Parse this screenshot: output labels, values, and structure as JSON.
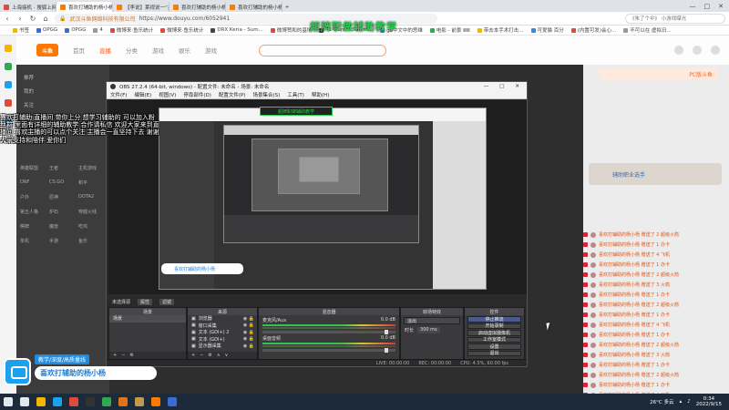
{
  "browser": {
    "tabs": [
      {
        "label": "上海接机 · 搜狐上网 从这里开始",
        "color": "#e04a3a",
        "active": false
      },
      {
        "label": "喜欢打辅助的杨小杨 个人空间_斗鱼",
        "color": "#ff7a00",
        "active": true
      },
      {
        "label": "【李说】莱视说一“共同”——路线教学",
        "color": "#ff7a00",
        "active": false
      },
      {
        "label": "喜欢打辅助的杨小杨的直播间",
        "color": "#ff7a00",
        "active": false
      },
      {
        "label": "喜欢打辅助的杨小杨 直播间直播_斗鱼",
        "color": "#ff7a00",
        "active": false
      }
    ],
    "window_controls": [
      "—",
      "□",
      "✕"
    ],
    "address": {
      "site_name": "武汉斗鱼网络科技有限公司",
      "url": "https://www.douyu.com/6052941",
      "search_text": "《朱了个伞》 小游戏曝光"
    },
    "bookmarks": [
      {
        "label": "书签",
        "color": "#f5b400"
      },
      {
        "label": "OPGG",
        "color": "#3b6bd6"
      },
      {
        "label": "OPGG",
        "color": "#3b6bd6"
      },
      {
        "label": "4",
        "color": "#999999"
      },
      {
        "label": "微博来·鱼乐统计",
        "color": "#e04a3a"
      },
      {
        "label": "微博来·鱼乐统计",
        "color": "#e04a3a"
      },
      {
        "label": "DRX Keria - Sum...",
        "color": "#444444"
      },
      {
        "label": "微博赞和的基情",
        "color": "#e04a3a"
      },
      {
        "label": "T1 Gumi - Summ...",
        "color": "#444444"
      },
      {
        "label": "go中文中的思维",
        "color": "#2a8af6"
      },
      {
        "label": "电影 - 前景 ⅢⅢ",
        "color": "#33a852"
      },
      {
        "label": "带去本手术打击...",
        "color": "#f5b400"
      },
      {
        "label": "可爱猫 百分",
        "color": "#2a8af6"
      },
      {
        "label": "(内置可发)会心...",
        "color": "#e04a3a"
      },
      {
        "label": "不可以在 虚拟日...",
        "color": "#999999"
      }
    ]
  },
  "douyu": {
    "logo": "斗鱼",
    "nav": [
      {
        "label": "首页",
        "hot": false
      },
      {
        "label": "直播",
        "hot": true
      },
      {
        "label": "分类",
        "hot": false
      },
      {
        "label": "游戏",
        "hot": false
      },
      {
        "label": "娱乐",
        "hot": false
      },
      {
        "label": "游戏",
        "hot": false
      }
    ],
    "banner": "超牌职做辅助教学",
    "sidebar": {
      "items": [
        "推荐",
        "我的",
        "关注",
        "专题",
        "推荐",
        "综合直播",
        "王者荣耀",
        "球球大作战",
        "和平精英",
        "英雄联盟",
        "CS:GO",
        "原神",
        "LOL",
        "DNF",
        "LOL"
      ],
      "grid": [
        "英雄联盟",
        "王者",
        "主机游戏",
        "DNF",
        "CS:GO",
        "和平",
        "户外",
        "原神",
        "DOTA2",
        "第五人格",
        "炉石",
        "穿越火线",
        "棋牌",
        "魔兽",
        "吃鸡",
        "单机",
        "手游",
        "鱼乐"
      ]
    },
    "right_header": "PC版斗鱼",
    "right_title": "辅助职业选手",
    "rank_list": [
      "喜欢打辅助的杨小杨 赠送了 2 超级火箭",
      "喜欢打辅助的杨小杨 赠送了 1 办卡",
      "喜欢打辅助的杨小杨 赠送了 4 飞机",
      "喜欢打辅助的杨小杨 赠送了 1 办卡",
      "喜欢打辅助的杨小杨 赠送了 2 超级火箭",
      "喜欢打辅助的杨小杨 赠送了 3 火箭",
      "喜欢打辅助的杨小杨 赠送了 1 办卡",
      "喜欢打辅助的杨小杨 赠送了 2 超级火箭",
      "喜欢打辅助的杨小杨 赠送了 1 办卡",
      "喜欢打辅助的杨小杨 赠送了 4 飞机",
      "喜欢打辅助的杨小杨 赠送了 1 办卡",
      "喜欢打辅助的杨小杨 赠送了 2 超级火箭",
      "喜欢打辅助的杨小杨 赠送了 3 火箭",
      "喜欢打辅助的杨小杨 赠送了 1 办卡",
      "喜欢打辅助的杨小杨 赠送了 2 超级火箭",
      "喜欢打辅助的杨小杨 赠送了 1 办卡",
      "喜欢打辅助的杨小杨 赠送了 4 飞机",
      "喜欢打辅助的杨小杨 赠送了 1 办卡"
    ]
  },
  "obs": {
    "title": "OBS 27.2.4 (64-bit, windows) - 配置文件: 未命名 - 场景: 未命名",
    "menu": [
      "文件(F)",
      "编辑(E)",
      "视图(V)",
      "停靠部件(D)",
      "配置文件(P)",
      "场景集合(S)",
      "工具(T)",
      "帮助(H)"
    ],
    "preview_label": "未选择源",
    "props_button": "属性",
    "filters_button": "滤镜",
    "docks": {
      "scenes": {
        "title": "场景",
        "items": [
          "场景"
        ]
      },
      "sources": {
        "title": "来源",
        "items": [
          "浏览器",
          "窗口采集",
          "文本 (GDI+) 2",
          "文本 (GDI+)",
          "显示器采集"
        ]
      },
      "mixer": {
        "title": "混音器",
        "channels": [
          {
            "name": "麦克风/Aux",
            "db": "0.0 dB"
          },
          {
            "name": "桌面音频",
            "db": "0.0 dB"
          }
        ]
      },
      "transitions": {
        "title": "转场特效",
        "type": "淡出",
        "duration_label": "时长",
        "duration": "300 ms"
      },
      "controls": {
        "title": "控件",
        "buttons": [
          "停止推流",
          "开始录制",
          "启动虚拟摄像机",
          "工作室模式",
          "设置",
          "退出"
        ]
      }
    },
    "status": {
      "live": "LIVE: 00:00:00",
      "rec": "REC: 00:00:00",
      "cpu": "CPU: 4.5%, 60.00 fps"
    }
  },
  "overlay": {
    "text": "喜欢打辅助 直播间 带你上分 想学习辅助的 可以加入粉丝群 里面有详细的辅助教学 合作请私信 欢迎大家来到直播间 喜欢主播的可以点个关注 主播会一直坚持下去 谢谢大家支持和陪伴 爱你们",
    "tag": "教学/深度/高质量线",
    "name": "喜欢打辅助的杨小杨"
  },
  "taskbar": {
    "icons": [
      {
        "name": "start",
        "color": "#e2e8f0"
      },
      {
        "name": "search",
        "color": "#e2e8f0"
      },
      {
        "name": "explorer",
        "color": "#f5b400"
      },
      {
        "name": "edge",
        "color": "#1aa2f0"
      },
      {
        "name": "browser",
        "color": "#e04a3a"
      },
      {
        "name": "obs",
        "color": "#333333"
      },
      {
        "name": "chrome",
        "color": "#33a852"
      },
      {
        "name": "app",
        "color": "#e2731d"
      },
      {
        "name": "app2",
        "color": "#c49a4a"
      },
      {
        "name": "douyu",
        "color": "#ff7a00"
      },
      {
        "name": "app3",
        "color": "#3b6bd6"
      }
    ],
    "weather": "26°C 多云",
    "time": "0:34",
    "date": "2022/9/15"
  }
}
